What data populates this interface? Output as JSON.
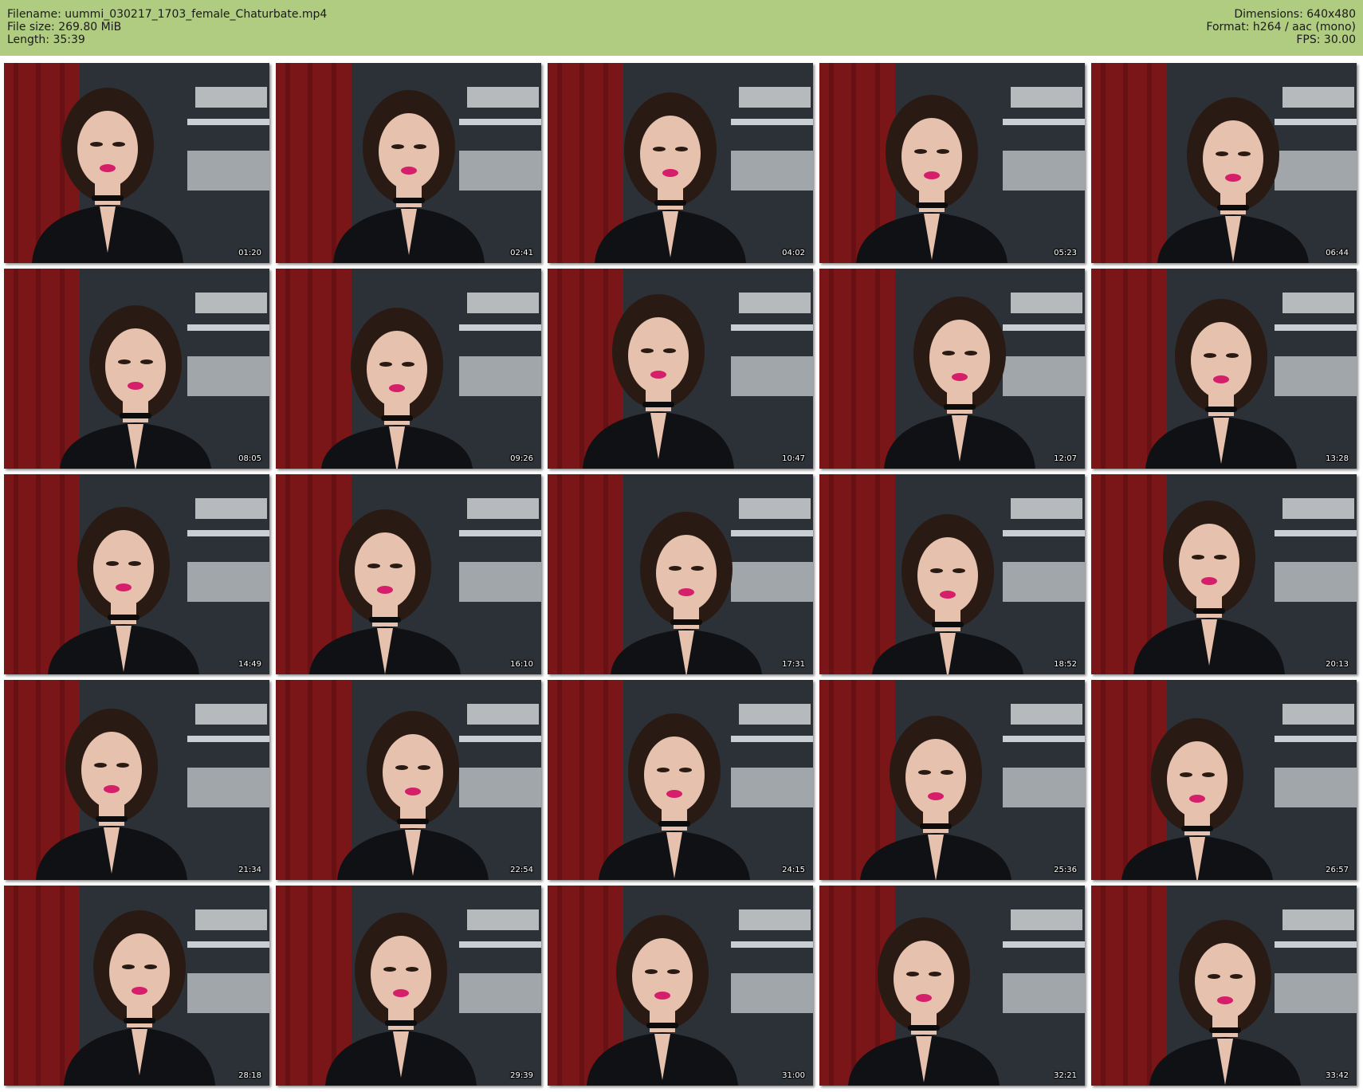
{
  "header": {
    "filename": "Filename: uummi_030217_1703_female_Chaturbate.mp4",
    "filesize": "File size: 269.80 MiB",
    "length": "Length: 35:39",
    "dimensions": "Dimensions: 640x480",
    "format": "Format: h264 / aac (mono)",
    "fps": "FPS: 30.00",
    "background_color": "#b0cc80"
  },
  "thumbnails": [
    {
      "timestamp": "01:20"
    },
    {
      "timestamp": "02:41"
    },
    {
      "timestamp": "04:02"
    },
    {
      "timestamp": "05:23"
    },
    {
      "timestamp": "06:44"
    },
    {
      "timestamp": "08:05"
    },
    {
      "timestamp": "09:26"
    },
    {
      "timestamp": "10:47"
    },
    {
      "timestamp": "12:07"
    },
    {
      "timestamp": "13:28"
    },
    {
      "timestamp": "14:49"
    },
    {
      "timestamp": "16:10"
    },
    {
      "timestamp": "17:31"
    },
    {
      "timestamp": "18:52"
    },
    {
      "timestamp": "20:13"
    },
    {
      "timestamp": "21:34"
    },
    {
      "timestamp": "22:54"
    },
    {
      "timestamp": "24:15"
    },
    {
      "timestamp": "25:36"
    },
    {
      "timestamp": "26:57"
    },
    {
      "timestamp": "28:18"
    },
    {
      "timestamp": "29:39"
    },
    {
      "timestamp": "31:00"
    },
    {
      "timestamp": "32:21"
    },
    {
      "timestamp": "33:42"
    }
  ],
  "frame_colors": {
    "curtain": "#7a1518",
    "wall": "#2b3136",
    "shelf": "#c9ced2",
    "clothing": "#101114",
    "hair": "#2a1a14",
    "skin": "#e6c2ae",
    "lips": "#d61f6a"
  }
}
